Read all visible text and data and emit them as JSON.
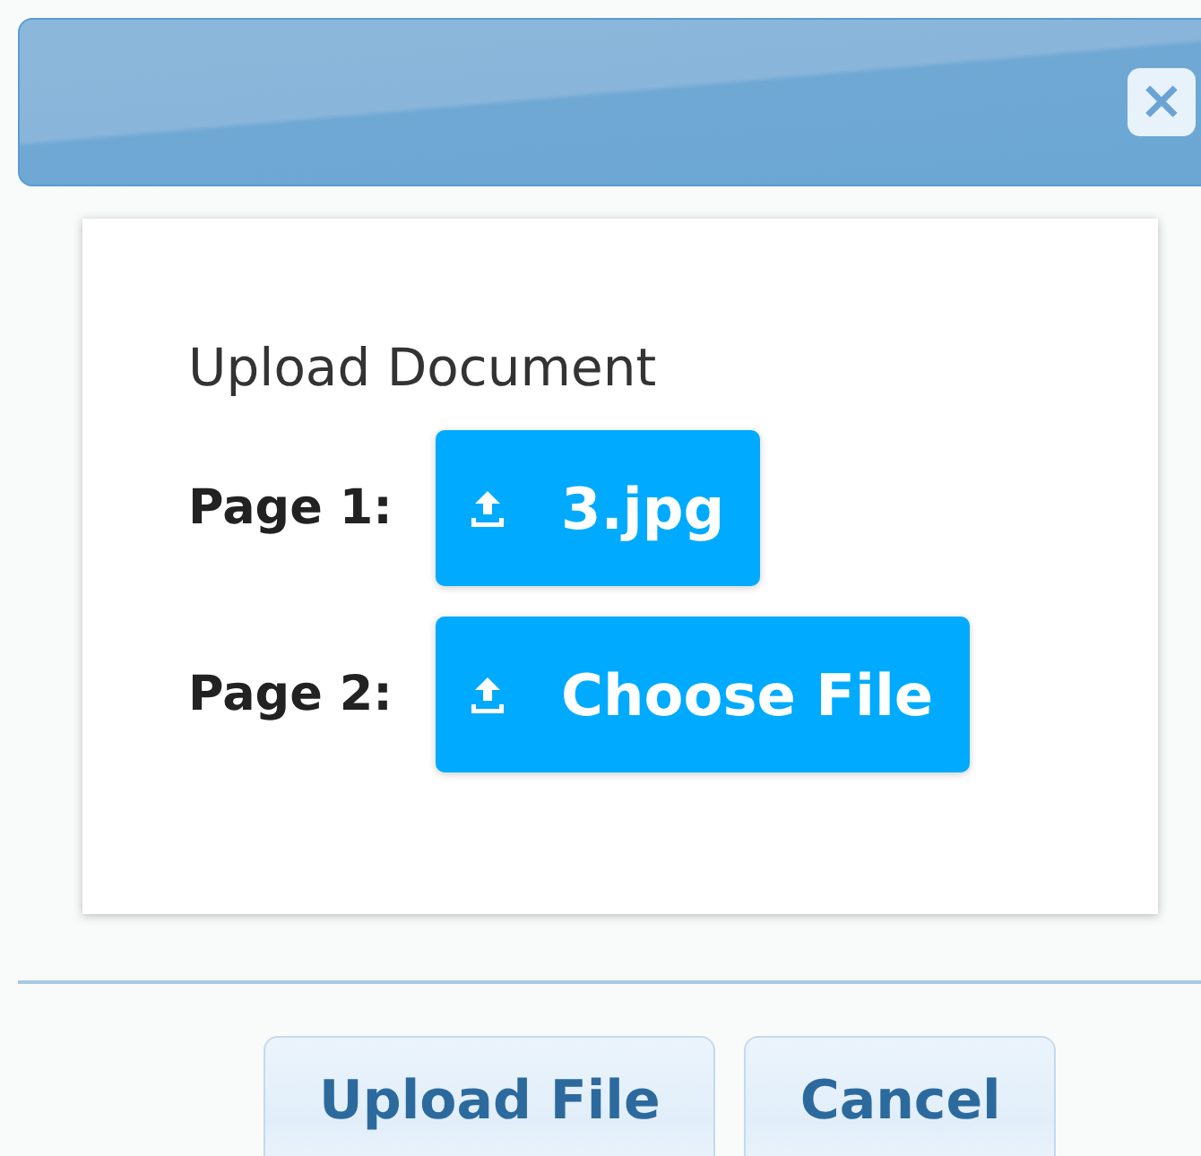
{
  "dialog": {
    "close_label": "×"
  },
  "form": {
    "heading": "Upload Document",
    "pages": [
      {
        "label": "Page 1:",
        "button": "3.jpg"
      },
      {
        "label": "Page 2:",
        "button": "Choose File"
      }
    ]
  },
  "buttons": [
    "Upload File",
    "Cancel"
  ]
}
